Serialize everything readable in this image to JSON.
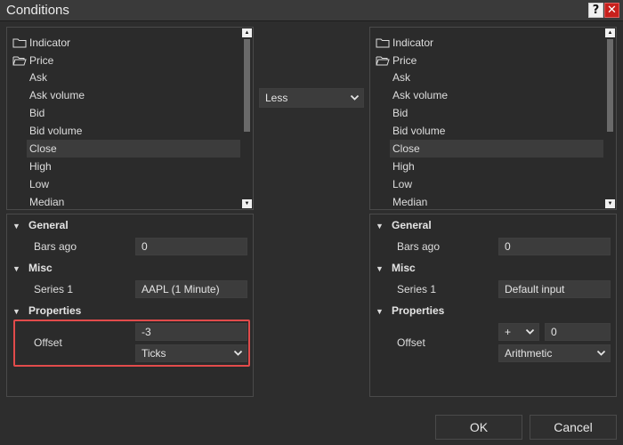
{
  "window": {
    "title": "Conditions",
    "help_label": "?",
    "close_label": "✕"
  },
  "left": {
    "tree": [
      {
        "label": "Indicator",
        "type": "folder"
      },
      {
        "label": "Price",
        "type": "folder"
      },
      {
        "label": "Ask",
        "type": "leaf"
      },
      {
        "label": "Ask volume",
        "type": "leaf"
      },
      {
        "label": "Bid",
        "type": "leaf"
      },
      {
        "label": "Bid volume",
        "type": "leaf"
      },
      {
        "label": "Close",
        "type": "leaf",
        "selected": true
      },
      {
        "label": "High",
        "type": "leaf"
      },
      {
        "label": "Low",
        "type": "leaf"
      },
      {
        "label": "Median",
        "type": "leaf"
      }
    ],
    "sections": {
      "general": "General",
      "bars_ago_label": "Bars ago",
      "bars_ago_value": "0",
      "misc": "Misc",
      "series_label": "Series 1",
      "series_value": "AAPL (1 Minute)",
      "properties": "Properties",
      "offset_label": "Offset",
      "offset_value": "-3",
      "offset_type": "Ticks"
    }
  },
  "operator": {
    "value": "Less"
  },
  "right": {
    "tree": [
      {
        "label": "Indicator",
        "type": "folder"
      },
      {
        "label": "Price",
        "type": "folder"
      },
      {
        "label": "Ask",
        "type": "leaf"
      },
      {
        "label": "Ask volume",
        "type": "leaf"
      },
      {
        "label": "Bid",
        "type": "leaf"
      },
      {
        "label": "Bid volume",
        "type": "leaf"
      },
      {
        "label": "Close",
        "type": "leaf",
        "selected": true
      },
      {
        "label": "High",
        "type": "leaf"
      },
      {
        "label": "Low",
        "type": "leaf"
      },
      {
        "label": "Median",
        "type": "leaf"
      }
    ],
    "sections": {
      "general": "General",
      "bars_ago_label": "Bars ago",
      "bars_ago_value": "0",
      "misc": "Misc",
      "series_label": "Series 1",
      "series_value": "Default input",
      "properties": "Properties",
      "offset_label": "Offset",
      "offset_sign": "+",
      "offset_value": "0",
      "offset_type": "Arithmetic"
    }
  },
  "buttons": {
    "ok": "OK",
    "cancel": "Cancel"
  },
  "colors": {
    "highlight": "#e24b4b",
    "close_button": "#c8201c"
  }
}
